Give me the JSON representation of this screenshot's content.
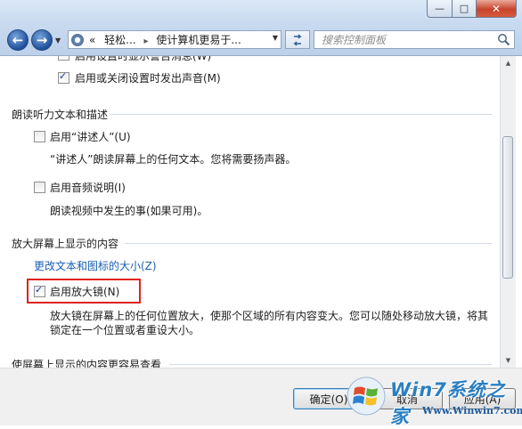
{
  "window": {
    "minimize": "—",
    "maximize": "□",
    "close": "✕"
  },
  "nav": {
    "breadcrumb_prefix": "«",
    "breadcrumb_1": "轻松...",
    "breadcrumb_2": "使计算机更易于...",
    "search_placeholder": "搜索控制面板"
  },
  "content": {
    "partial_item": "启用设置时显示警告消息(W)",
    "sound_item": "启用或关闭设置时发出声音(M)",
    "section_narrator": "朗读听力文本和描述",
    "narrator_item": "启用“讲述人”(U)",
    "narrator_desc": "“讲述人”朗读屏幕上的任何文本。您将需要扬声器。",
    "audio_desc_item": "启用音频说明(I)",
    "audio_desc_desc": "朗读视频中发生的事(如果可用)。",
    "section_magnify": "放大屏幕上显示的内容",
    "change_size_link": "更改文本和图标的大小(Z)",
    "magnifier_item": "启用放大镜(N)",
    "magnifier_desc_1": "放大镜在屏幕上的任何位置放大，使那个区域的所有内容变大。您可以随处移动放大镜，将其",
    "magnifier_desc_2": "锁定在一个位置或者重设大小。",
    "section_easier": "使屏幕上显示的内容更容易查看"
  },
  "buttons": {
    "ok": "确定(O)",
    "cancel": "取消",
    "apply": "应用(A)"
  },
  "watermark": {
    "brand": "Win7系统之家",
    "url": "Www.Winwin7.com"
  },
  "checkbox_states": {
    "partial_item": true,
    "sound_item": true,
    "narrator_item": false,
    "audio_desc_item": false,
    "magnifier_item": true
  },
  "colors": {
    "link": "#1a5fb4",
    "highlight_box": "#e0221e",
    "close_button": "#c8442c"
  }
}
